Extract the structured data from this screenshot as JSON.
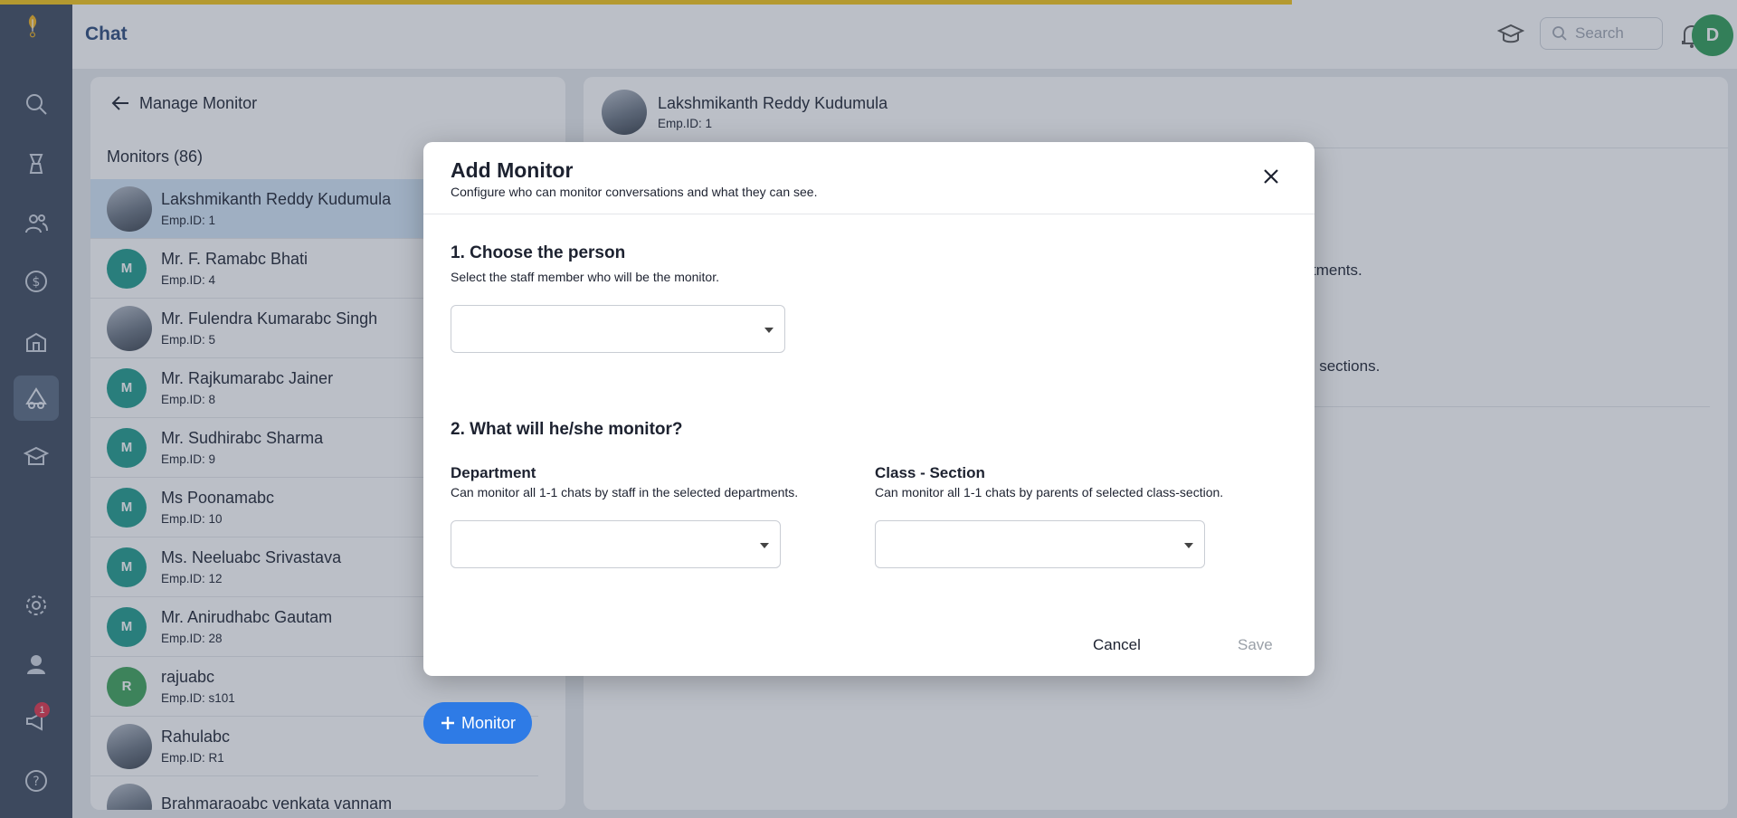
{
  "header": {
    "title": "Chat",
    "search_placeholder": "Search",
    "avatar_letter": "D"
  },
  "nav": {
    "announcement_badge": "1",
    "items": [
      "search-icon",
      "lamp-icon",
      "people-icon",
      "dollar-icon",
      "school-icon",
      "chat-monitor-icon",
      "academy-icon",
      "gear-icon",
      "support-agent-icon",
      "megaphone-icon",
      "help-icon"
    ]
  },
  "left_panel": {
    "back_label": "Manage Monitor",
    "count_label": "Monitors (86)",
    "fab_label": "Monitor",
    "monitors": [
      {
        "name": "Lakshmikanth Reddy Kudumula",
        "emp": "Emp.ID: 1",
        "avatar": "photo"
      },
      {
        "name": "Mr. F. Ramabc Bhati",
        "emp": "Emp.ID: 4",
        "avatar": "M"
      },
      {
        "name": "Mr. Fulendra Kumarabc Singh",
        "emp": "Emp.ID: 5",
        "avatar": "photo"
      },
      {
        "name": "Mr. Rajkumarabc Jainer",
        "emp": "Emp.ID: 8",
        "avatar": "M"
      },
      {
        "name": "Mr. Sudhirabc Sharma",
        "emp": "Emp.ID: 9",
        "avatar": "M"
      },
      {
        "name": "Ms Poonamabc",
        "emp": "Emp.ID: 10",
        "avatar": "M"
      },
      {
        "name": "Ms. Neeluabc Srivastava",
        "emp": "Emp.ID: 12",
        "avatar": "M"
      },
      {
        "name": "Mr. Anirudhabc Gautam",
        "emp": "Emp.ID: 28",
        "avatar": "M"
      },
      {
        "name": "rajuabc",
        "emp": "Emp.ID: s101",
        "avatar": "R"
      },
      {
        "name": "Rahulabc",
        "emp": "Emp.ID: R1",
        "avatar": "photo"
      },
      {
        "name": "Brahmaraoabc venkata vannam",
        "emp": "",
        "avatar": "photo"
      }
    ]
  },
  "right_panel": {
    "name": "Lakshmikanth Reddy Kudumula",
    "emp": "Emp.ID: 1",
    "partial_text_1": "tments.",
    "partial_text_2": "s sections."
  },
  "modal": {
    "title": "Add Monitor",
    "subtitle": "Configure who can monitor conversations and what they can see.",
    "step1_title": "1. Choose the person",
    "step1_help": "Select the staff member who will be the monitor.",
    "step2_title": "2. What will he/she monitor?",
    "department_label": "Department",
    "department_help": "Can monitor all 1-1 chats by staff in the selected departments.",
    "class_label": "Class - Section",
    "class_help": "Can monitor all 1-1 chats by parents of selected class-section.",
    "cancel_label": "Cancel",
    "save_label": "Save"
  }
}
